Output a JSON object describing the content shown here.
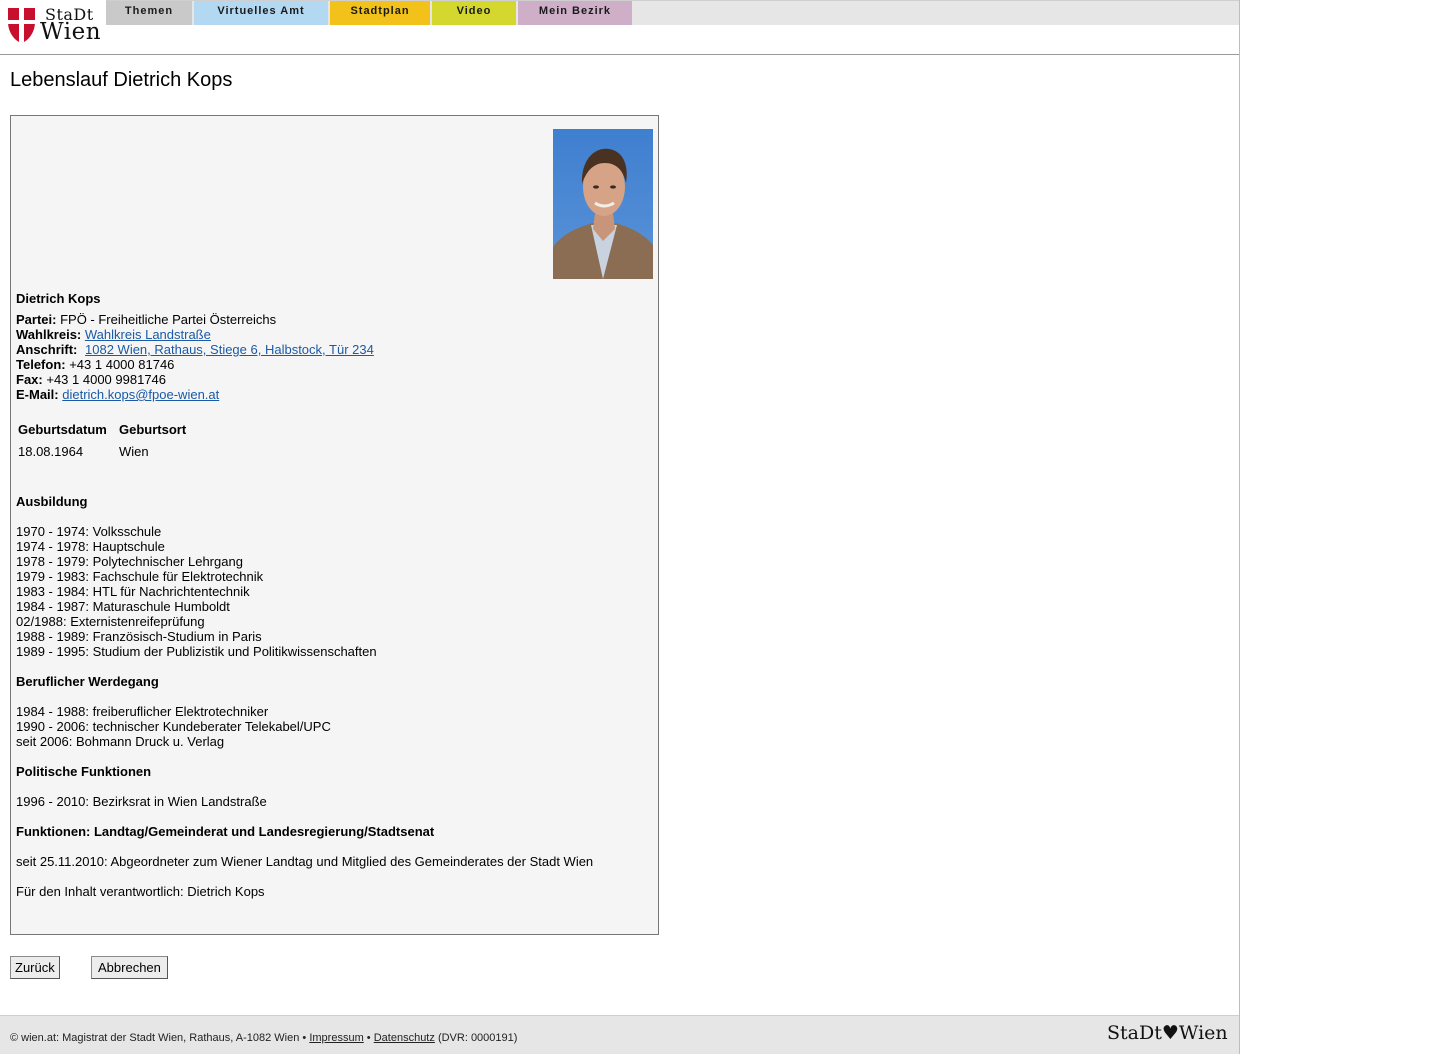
{
  "header": {
    "logo": {
      "line1": "StaDt",
      "line2": "Wien"
    },
    "nav": [
      {
        "label": "Themen",
        "color": "#c9c9c9"
      },
      {
        "label": "Virtuelles Amt",
        "color": "#b3d9f2"
      },
      {
        "label": "Stadtplan",
        "color": "#f2c21b"
      },
      {
        "label": "Video",
        "color": "#d4d82e"
      },
      {
        "label": "Mein Bezirk",
        "color": "#cfafc8"
      }
    ]
  },
  "page": {
    "title": "Lebenslauf Dietrich Kops"
  },
  "profile": {
    "name": "Dietrich Kops",
    "party_label": "Partei:",
    "party": "FPÖ - Freiheitliche Partei Österreichs",
    "district_label": "Wahlkreis:",
    "district": "Wahlkreis Landstraße",
    "address_label": "Anschrift:",
    "address": "1082 Wien, Rathaus, Stiege 6, Halbstock, Tür 234",
    "phone_label": "Telefon:",
    "phone": "+43 1 4000 81746",
    "fax_label": "Fax:",
    "fax": "+43 1 4000 9981746",
    "email_label": "E-Mail:",
    "email": "dietrich.kops@fpoe-wien.at"
  },
  "birth_table": {
    "headers": [
      "Geburtsdatum",
      "Geburtsort"
    ],
    "row": [
      "18.08.1964",
      "Wien"
    ]
  },
  "sections": {
    "education": {
      "title": "Ausbildung",
      "items": [
        "1970 - 1974: Volksschule",
        "1974 - 1978: Hauptschule",
        "1978 - 1979: Polytechnischer Lehrgang",
        "1979 - 1983: Fachschule für Elektrotechnik",
        "1983 - 1984: HTL für Nachrichtentechnik",
        "1984 - 1987: Maturaschule Humboldt",
        "02/1988: Externistenreifeprüfung",
        "1988 - 1989: Französisch-Studium in Paris",
        "1989 - 1995: Studium der Publizistik und Politikwissenschaften"
      ]
    },
    "career": {
      "title": "Beruflicher Werdegang",
      "items": [
        "1984 - 1988: freiberuflicher Elektrotechniker",
        "1990 - 2006: technischer Kundeberater Telekabel/UPC",
        "seit 2006: Bohmann Druck u. Verlag"
      ]
    },
    "political": {
      "title": "Politische Funktionen",
      "items": [
        "1996 - 2010: Bezirksrat in Wien Landstraße"
      ]
    },
    "functions": {
      "title": "Funktionen: Landtag/Gemeinderat und Landesregierung/Stadtsenat",
      "items": [
        "seit 25.11.2010: Abgeordneter zum Wiener Landtag und Mitglied des Gemeinderates der Stadt Wien"
      ]
    }
  },
  "responsible": "Für den Inhalt verantwortlich: Dietrich Kops",
  "buttons": {
    "back": "Zurück",
    "cancel": "Abbrechen"
  },
  "footer": {
    "copyright": "© wien.at: Magistrat der Stadt Wien, Rathaus, A-1082 Wien •",
    "imprint": "Impressum",
    "sep": "•",
    "privacy": "Datenschutz",
    "dvr": "(DVR: 0000191)",
    "logo": "StaDt♥Wien"
  },
  "colors": {
    "link": "#1a5aa6",
    "brand_red": "#c8102e",
    "box_bg": "#f5f5f5"
  }
}
